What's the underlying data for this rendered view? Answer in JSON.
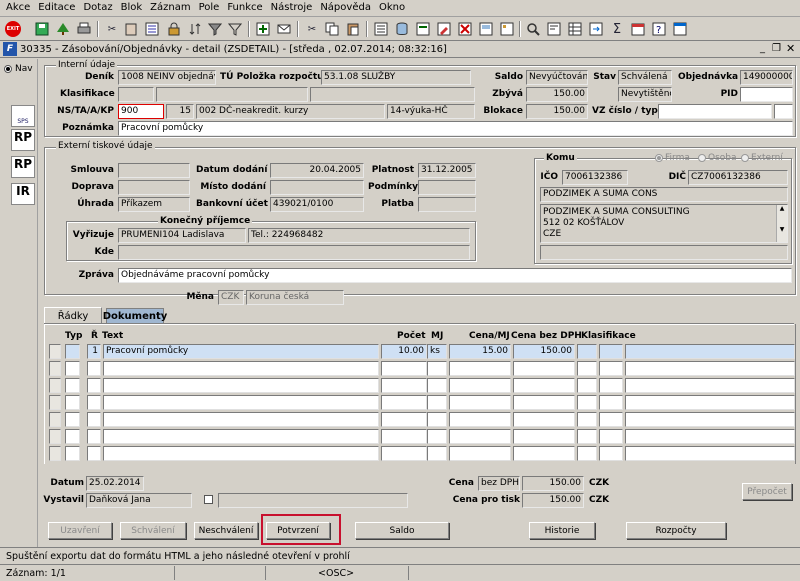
{
  "menu": [
    "Akce",
    "Editace",
    "Dotaz",
    "Blok",
    "Záznam",
    "Pole",
    "Funkce",
    "Nástroje",
    "Nápověda",
    "Okno"
  ],
  "toolbar": {
    "exit_label": "EXIT",
    "icons": [
      "exit-icon",
      "save-icon",
      "tree-icon",
      "print-icon",
      "cut-icon",
      "clipboard-icon",
      "select-all-icon",
      "filter-icon",
      "email-icon",
      "scissors-icon",
      "copy-icon",
      "paste-icon",
      "list-icon",
      "data-icon",
      "insert-row-icon",
      "delete-row-icon",
      "sigma-icon",
      "calendar-icon",
      "help-icon",
      "window-icon"
    ]
  },
  "window": {
    "title": "30335 - Zásobování/Objednávky - detail (ZSDETAIL) - [středa , 02.07.2014; 08:32:16]"
  },
  "nav": {
    "label": "Nav",
    "sps": "SPS",
    "rp1": "RP",
    "rp2": "RP",
    "ir": "IR"
  },
  "internal": {
    "legend": "Interní údaje",
    "denik_label": "Deník",
    "denik": "1008 NEINV objednávky",
    "tu_label": "TÚ Položka rozpočtu",
    "tu": "53.1.08 SLUŽBY",
    "saldo_label": "Saldo",
    "saldo": "Nevyúčtováno",
    "stav_label": "Stav",
    "stav": "Schválená",
    "objednavka_label": "Objednávka",
    "objednavka": "1490000002",
    "klasifikace_label": "Klasifikace",
    "zbyva_label": "Zbývá",
    "zbyva": "150.00",
    "nevytisteno": "Nevytištěno",
    "pid_label": "PID",
    "nstakp_label": "NS/TA/A/KP",
    "ns": "900",
    "ta": "15",
    "a": "002 DČ-neakredit. kurzy",
    "kp": "14-výuka-HČ",
    "blokace_label": "Blokace",
    "blokace": "150.00",
    "vz_label": "VZ číslo / typ",
    "poznamka_label": "Poznámka",
    "poznamka": "Pracovní pomůcky"
  },
  "external": {
    "legend": "Externí tiskové údaje",
    "smlouva_label": "Smlouva",
    "datum_dodani_label": "Datum dodání",
    "datum_dodani": "20.04.2005",
    "platnost_label": "Platnost",
    "platnost": "31.12.2005",
    "doprava_label": "Doprava",
    "misto_dodani_label": "Místo dodání",
    "podminky_label": "Podmínky",
    "uhrada_label": "Úhrada",
    "uhrada": "Příkazem",
    "bankovni_ucet_label": "Bankovní účet",
    "bankovni_ucet": "439021/0100",
    "platba_label": "Platba",
    "prijemce_legend": "Konečný příjemce",
    "vyrizuje_label": "Vyřizuje",
    "vyrizuje": "PRUMENI104 Ladislava",
    "tel": "Tel.: 224968482",
    "kde_label": "Kde",
    "zprava_label": "Zpráva",
    "zprava": "Objednáváme pracovní pomůcky",
    "mena_label": "Měna",
    "mena": "CZK",
    "mena_name": "Koruna česká"
  },
  "komu": {
    "legend": "Komu",
    "firma": "Firma",
    "osoba": "Osoba",
    "externi": "Externí",
    "ico_label": "IČO",
    "ico": "7006132386",
    "dic_label": "DIČ",
    "dic": "CZ7006132386",
    "name": "PODZIMEK A SUMA CONS",
    "addr1": "PODZIMEK A SUMA CONSULTING",
    "addr2": "512 02  KOŠŤÁLOV",
    "addr3": "CZE"
  },
  "tabs": {
    "radky": "Řádky",
    "dokumenty": "Dokumenty"
  },
  "table": {
    "headers": {
      "typ": "Typ",
      "r": "Ř",
      "text": "Text",
      "pocet": "Počet",
      "mj": "MJ",
      "cena_mj": "Cena/MJ",
      "cena_bez": "Cena bez DPH",
      "klasifikace": "Klasifikace"
    },
    "rows": [
      {
        "typ": "",
        "r": "1",
        "text": "Pracovní pomůcky",
        "pocet": "10.00",
        "mj": "ks",
        "cena_mj": "15.00",
        "cena_bez": "150.00",
        "klas": ""
      }
    ]
  },
  "footer": {
    "datum_label": "Datum",
    "datum": "25.02.2014",
    "vystavil_label": "Vystavil",
    "vystavil": "Daňková Jana",
    "cena_label": "Cena",
    "bez_dph": "bez DPH",
    "cena": "150.00",
    "czk1": "CZK",
    "cena_tisk_label": "Cena pro tisk",
    "cena_tisk": "150.00",
    "czk2": "CZK",
    "prepocet": "Přepočet"
  },
  "buttons": {
    "uzavreni": "Uzavření",
    "schvaleni": "Schválení",
    "neschvaleni": "Neschválení",
    "potvrzeni": "Potvrzení",
    "saldo": "Saldo",
    "historie": "Historie",
    "rozpocty": "Rozpočty"
  },
  "status": {
    "message": "Spuštění exportu dat do formátu HTML a jeho následné otevření v prohlí",
    "record": "Záznam: 1/1",
    "osc": "<OSC>"
  }
}
